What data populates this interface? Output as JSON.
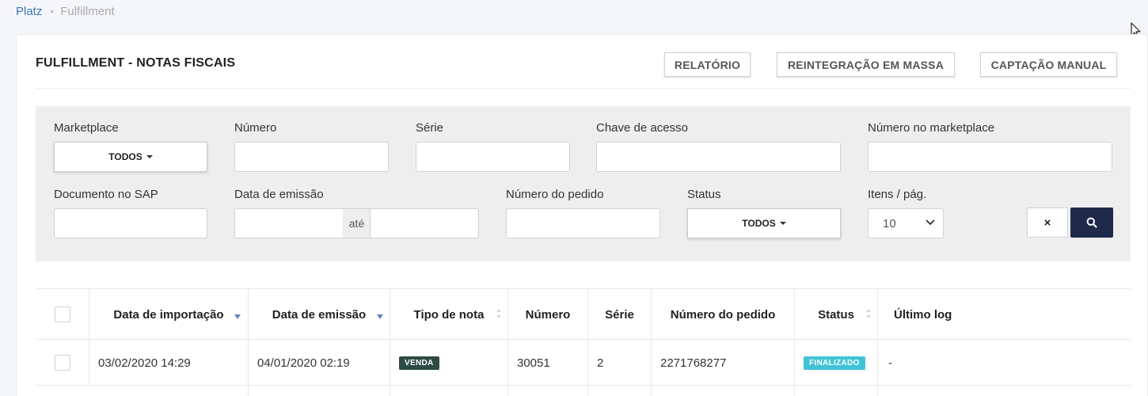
{
  "breadcrumb": {
    "root": "Platz",
    "current": "Fulfillment"
  },
  "page": {
    "title": "FULFILLMENT - NOTAS FISCAIS",
    "actions": {
      "report": "RELATÓRIO",
      "mass_reintegration": "REINTEGRAÇÃO EM MASSA",
      "manual_capture": "CAPTAÇÃO MANUAL"
    }
  },
  "filters": {
    "marketplace": {
      "label": "Marketplace",
      "value": "TODOS"
    },
    "numero": {
      "label": "Número",
      "value": ""
    },
    "serie": {
      "label": "Série",
      "value": ""
    },
    "chave": {
      "label": "Chave de acesso",
      "value": ""
    },
    "numero_marketplace": {
      "label": "Número no marketplace",
      "value": ""
    },
    "documento_sap": {
      "label": "Documento no SAP",
      "value": ""
    },
    "data_emissao": {
      "label": "Data de emissão",
      "from": "",
      "separator": "até",
      "to": ""
    },
    "numero_pedido": {
      "label": "Número do pedido",
      "value": ""
    },
    "status": {
      "label": "Status",
      "value": "TODOS"
    },
    "itens_pag": {
      "label": "Itens / pág.",
      "value": "10"
    },
    "clear_label": "×"
  },
  "table": {
    "columns": {
      "data_importacao": "Data de importação",
      "data_emissao": "Data de emissão",
      "tipo_nota": "Tipo de nota",
      "numero": "Número",
      "serie": "Série",
      "numero_pedido": "Número do pedido",
      "status": "Status",
      "ultimo_log": "Último log"
    },
    "rows": [
      {
        "data_importacao": "03/02/2020 14:29",
        "data_emissao": "04/01/2020 02:19",
        "tipo_nota": "VENDA",
        "numero": "30051",
        "serie": "2",
        "numero_pedido": "2271768277",
        "status": "FINALIZADO",
        "ultimo_log": "-"
      }
    ]
  },
  "colors": {
    "accent_dark": "#1f2a4a",
    "badge_venda": "#2e4a45",
    "badge_finalizado": "#3fc3d6",
    "link": "#3f78b8",
    "sort_active": "#6b82c2"
  }
}
